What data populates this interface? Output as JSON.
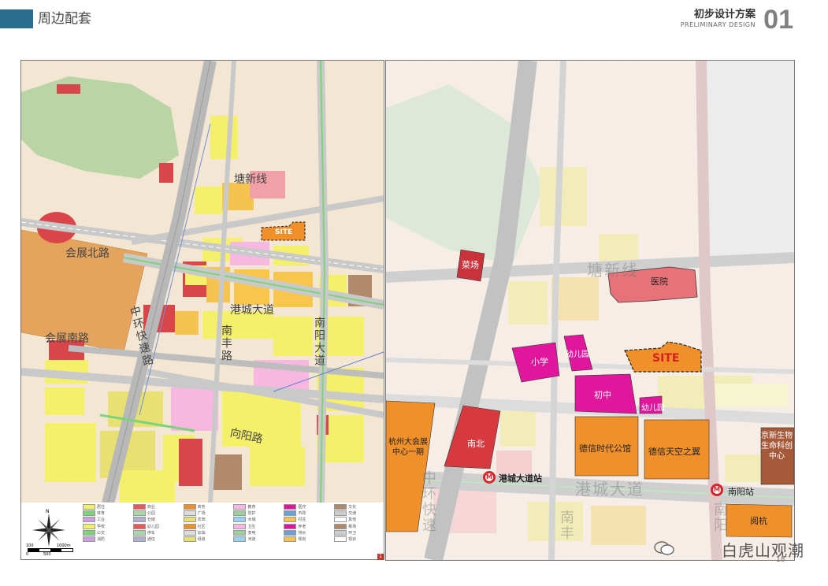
{
  "header": {
    "section_title": "周边配套",
    "doc_title": "初步设计方案",
    "doc_subtitle": "PRELIMINARY DESIGN",
    "doc_number": "01"
  },
  "left_map": {
    "road_labels": {
      "tangxin": "塘新线",
      "huizhan_bei": "会展北路",
      "huizhan_nan": "会展南路",
      "zhonghuan": "中环快速路",
      "gangcheng": "港城大道",
      "nanfeng": "南丰路",
      "nanyang": "南阳大道",
      "xiangyang": "向阳路"
    },
    "site_label": "SITE"
  },
  "right_map": {
    "road_labels": {
      "tangxin": "塘新线",
      "gangcheng": "港城大道",
      "zhonghuan": "中环快速",
      "nan": "南丰",
      "nanyang": "南阳"
    },
    "places": {
      "market": "菜场",
      "hospital": "医院",
      "primary_school": "小学",
      "kindergarten_1": "幼儿园",
      "kindergarten_2": "幼儿园",
      "middle_school": "初中",
      "high_school": "南北",
      "expo": "杭州大会展中心一期",
      "dexin_times": "德信时代公馆",
      "dexin_sky": "德信天空之翼",
      "biotech": "京新生物生命科创中心",
      "yuehang": "阅杭",
      "site": "SITE"
    },
    "stations": {
      "gangcheng_station": "港城大道站",
      "nanyang_station": "南阳站"
    }
  },
  "legend": {
    "scale_labels": [
      "100",
      "1000m",
      "0",
      "500"
    ],
    "north": "N",
    "items": [
      "居住",
      "商业",
      "商务",
      "教育",
      "医疗",
      "文化",
      "体育",
      "公园",
      "广场",
      "防护",
      "市政",
      "交通",
      "工业",
      "仓储",
      "农田",
      "水域",
      "村庄",
      "其他",
      "学校",
      "幼儿园",
      "社区",
      "卫生",
      "养老",
      "菜场",
      "公交",
      "停车",
      "加油",
      "变电",
      "排水",
      "环卫",
      "消防",
      "通信",
      "绿道",
      "河道",
      "规划",
      "现状"
    ],
    "page_num": "1"
  },
  "footer": {
    "watermark": "白虎山观潮",
    "page_number": "18"
  },
  "colors": {
    "accent": "#2b6d8e",
    "school": "#e0169c",
    "residential_orange": "#f0902a",
    "hospital": "#e8727a",
    "red_dark": "#d6262b"
  }
}
